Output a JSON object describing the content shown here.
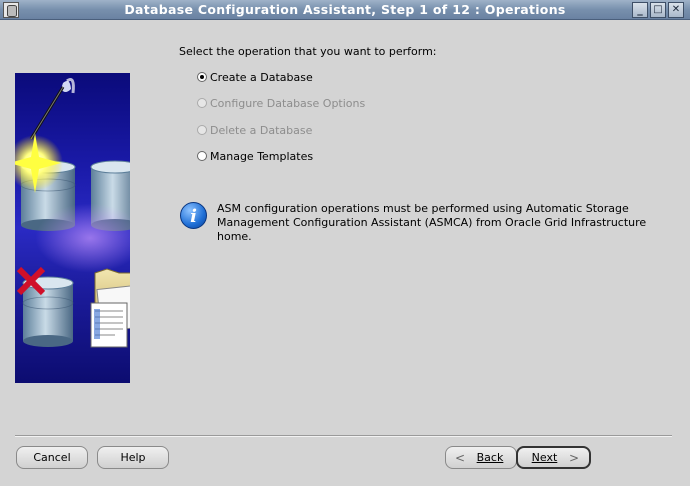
{
  "window": {
    "title": "Database Configuration Assistant, Step 1 of 12 : Operations",
    "controls": {
      "minimize": "_",
      "maximize": "□",
      "close": "✕"
    }
  },
  "main": {
    "prompt": "Select the operation that you want to perform:",
    "options": [
      {
        "label": "Create a Database",
        "selected": true,
        "enabled": true
      },
      {
        "label": "Configure Database Options",
        "selected": false,
        "enabled": false
      },
      {
        "label": "Delete a Database",
        "selected": false,
        "enabled": false
      },
      {
        "label": "Manage Templates",
        "selected": false,
        "enabled": true
      }
    ],
    "info": {
      "icon": "info-icon",
      "glyph": "i",
      "text": "ASM configuration operations must be performed using Automatic Storage Management Configuration Assistant (ASMCA) from Oracle Grid Infrastructure home."
    }
  },
  "footer": {
    "cancel": "Cancel",
    "help": "Help",
    "back": "Back",
    "next": "Next",
    "back_arrow": "<",
    "next_arrow": ">"
  },
  "colors": {
    "title_bar": "#7890ad",
    "art_background": "#1a1aa8",
    "check_mark": "#d0102a",
    "info_icon": "#1f6fd6"
  }
}
